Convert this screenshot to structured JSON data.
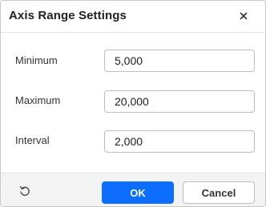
{
  "dialog": {
    "title": "Axis Range Settings",
    "close_icon": "close-icon"
  },
  "fields": [
    {
      "label": "Minimum",
      "value": "5,000"
    },
    {
      "label": "Maximum",
      "value": "20,000"
    },
    {
      "label": "Interval",
      "value": "2,000"
    }
  ],
  "footer": {
    "reset_icon": "reset-icon",
    "ok_label": "OK",
    "cancel_label": "Cancel"
  },
  "colors": {
    "primary": "#0d6efd",
    "footer_bg": "#f3f3f3"
  }
}
